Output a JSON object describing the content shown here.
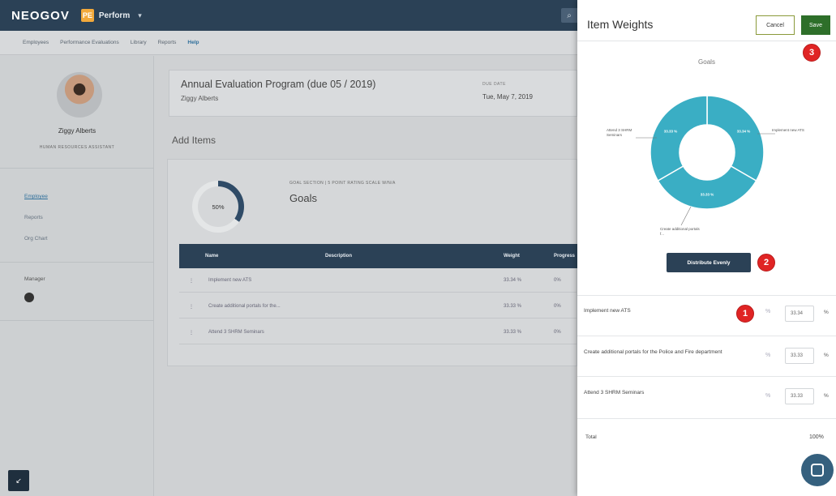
{
  "topbar": {
    "logo": "NEOGOV",
    "product_badge": "PE",
    "product": "Perform"
  },
  "subnav": {
    "items": [
      "Employees",
      "Performance Evaluations",
      "Library",
      "Reports",
      "Help"
    ]
  },
  "sidebar": {
    "user_name": "Ziggy Alberts",
    "user_role": "HUMAN RESOURCES ASSISTANT",
    "links": [
      "Employee",
      "Reports",
      "Org Chart"
    ],
    "manager_label": "Manager"
  },
  "evaluation": {
    "title": "Annual Evaluation Program (due 05 / 2019)",
    "employee": "Ziggy Alberts",
    "date_label": "DUE DATE",
    "date": "Tue, May 7, 2019"
  },
  "add_items_heading": "Add Items",
  "goals": {
    "progress_text": "50%",
    "progress_fraction": 0.35,
    "section_label": "GOAL SECTION | 5 POINT RATING SCALE W/N/A",
    "title": "Goals",
    "columns": [
      "Name",
      "Description",
      "Weight",
      "Progress"
    ],
    "rows": [
      {
        "name": "Implement new ATS",
        "weight": "33.34 %",
        "progress": "0%"
      },
      {
        "name": "Create additional portals for the...",
        "weight": "33.33 %",
        "progress": "0%"
      },
      {
        "name": "Attend 3 SHRM Seminars",
        "weight": "33.33 %",
        "progress": "0%"
      }
    ]
  },
  "panel": {
    "title": "Item Weights",
    "cancel": "Cancel",
    "save": "Save",
    "chart_heading": "Goals",
    "distribute": "Distribute Evenly",
    "items": [
      {
        "name": "Implement new ATS",
        "value": "33.34",
        "unit": "%"
      },
      {
        "name": "Create additional portals for the Police and Fire department",
        "value": "33.33",
        "unit": "%"
      },
      {
        "name": "Attend 3 SHRM Seminars",
        "value": "33.33",
        "unit": "%"
      }
    ],
    "total_label": "Total",
    "total_value": "100%",
    "markers": [
      "1",
      "2",
      "3"
    ]
  },
  "chart_data": {
    "type": "pie",
    "title": "Goals",
    "categories": [
      "Implement new ATS",
      "Create additional portals f...",
      "Attend 3 SHRM Seminars"
    ],
    "values": [
      33.34,
      33.33,
      33.33
    ],
    "value_labels": [
      "33.34 %",
      "33.33 %",
      "33.33 %"
    ],
    "color": "#3aaec4"
  },
  "colors": {
    "nav": "#2b4156",
    "save": "#2e6f2a",
    "marker": "#e02424",
    "donut": "#3aaec4"
  }
}
